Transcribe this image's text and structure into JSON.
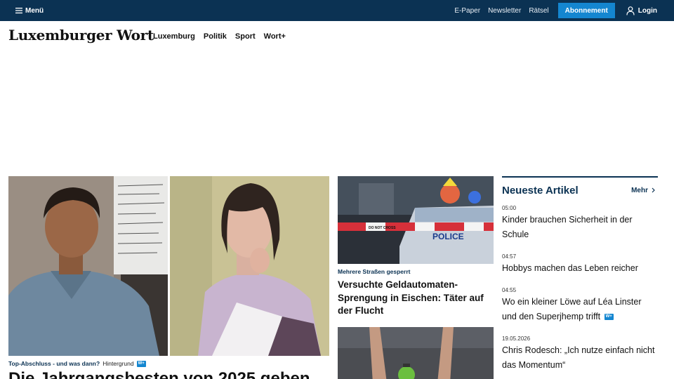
{
  "topbar": {
    "menu_label": "Menü",
    "links": [
      "E-Paper",
      "Newsletter",
      "Rätsel"
    ],
    "subscribe_label": "Abonnement",
    "login_label": "Login"
  },
  "brand": {
    "name": "Luxemburger Wort"
  },
  "nav": {
    "items": [
      "Luxemburg",
      "Politik",
      "Sport",
      "Wort+"
    ]
  },
  "lead": {
    "kicker": "Top-Abschluss - und was dann?",
    "category": "Hintergrund",
    "badge": "W+",
    "headline": "Die Jahrgangsbesten von 2025 geben"
  },
  "middle": {
    "article1": {
      "kicker": "Mehrere Straßen gesperrt",
      "headline": "Versuchte Geldautomaten-Sprengung in Eischen: Täter auf der Flucht",
      "image_tape_text": "DO NOT CROSS",
      "image_car_text": "POLICE"
    }
  },
  "latest": {
    "title": "Neueste Artikel",
    "more_label": "Mehr",
    "badge": "W+",
    "items": [
      {
        "time": "05:00",
        "title": "Kinder brauchen Sicherheit in der Schule"
      },
      {
        "time": "04:57",
        "title": "Hobbys machen das Leben reicher"
      },
      {
        "time": "04:55",
        "title": "Wo ein kleiner Löwe auf Léa Linster und den Superjhemp trifft"
      },
      {
        "time": "19.05.2026",
        "title": "Chris Rodesch: „Ich nutze einfach nicht das Momentum“"
      }
    ]
  },
  "colors": {
    "navy": "#0b3253",
    "accent_blue": "#1486d0"
  }
}
